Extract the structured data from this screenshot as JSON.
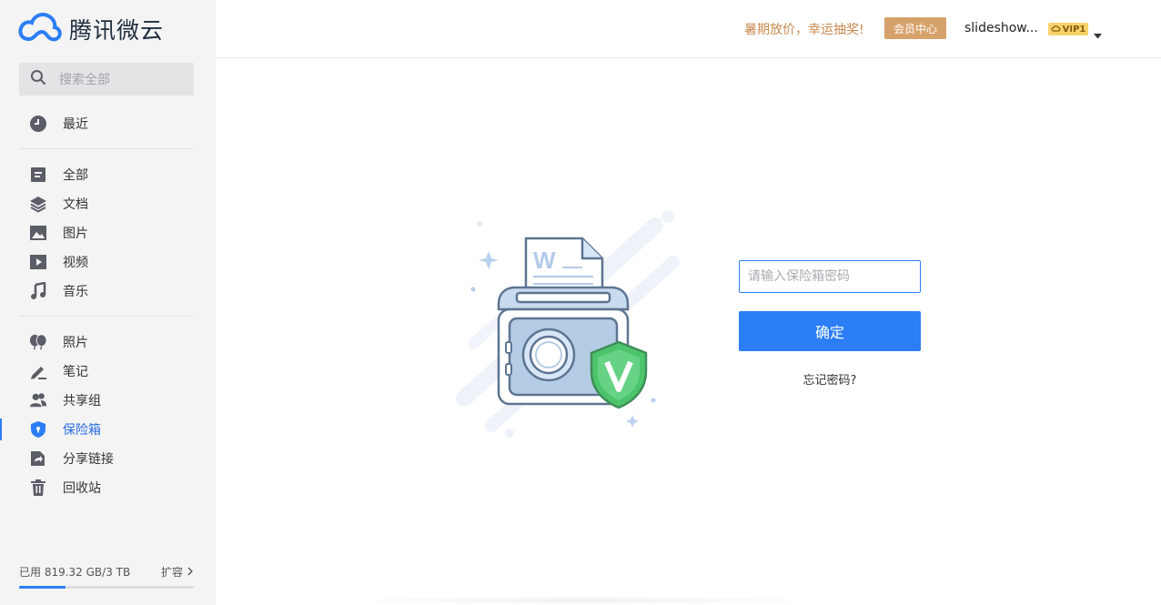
{
  "app": {
    "logo_text": "腾讯微云"
  },
  "search": {
    "placeholder": "搜索全部"
  },
  "sidebar": {
    "groups": [
      [
        {
          "label": "最近",
          "icon": "clock-icon"
        }
      ],
      [
        {
          "label": "全部",
          "icon": "file-icon"
        },
        {
          "label": "文档",
          "icon": "layers-icon"
        },
        {
          "label": "图片",
          "icon": "image-icon"
        },
        {
          "label": "视频",
          "icon": "play-icon"
        },
        {
          "label": "音乐",
          "icon": "music-icon"
        }
      ],
      [
        {
          "label": "照片",
          "icon": "balloons-icon"
        },
        {
          "label": "笔记",
          "icon": "pen-icon"
        },
        {
          "label": "共享组",
          "icon": "users-icon"
        },
        {
          "label": "保险箱",
          "icon": "shield-icon",
          "active": true
        },
        {
          "label": "分享链接",
          "icon": "share-icon"
        },
        {
          "label": "回收站",
          "icon": "trash-icon"
        }
      ]
    ],
    "active_color": "#2b7ef5"
  },
  "storage": {
    "used_text": "已用 819.32 GB/3 TB",
    "used_fraction": 0.2667,
    "expand_label": "扩容"
  },
  "header": {
    "promo": "暑期放价，幸运抽奖!",
    "vip_center": "会员中心",
    "username": "slideshow...",
    "vip_level": "VIP1"
  },
  "vault": {
    "password_placeholder": "请输入保险箱密码",
    "confirm_label": "确定",
    "forgot_label": "忘记密码?"
  },
  "colors": {
    "primary": "#2b7ef5",
    "vip_gold": "#d6a26b",
    "promo": "#c9894e",
    "shield_green": "#4cc46b"
  }
}
